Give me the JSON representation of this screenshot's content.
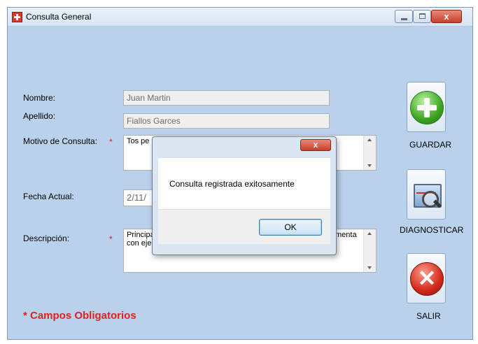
{
  "window": {
    "title": "Consulta General",
    "close_glyph": "x"
  },
  "form": {
    "nombre_label": "Nombre:",
    "nombre_value": "Juan Martin",
    "apellido_label": "Apellido:",
    "apellido_value": "Fiallos Garces",
    "motivo_label": "Motivo de Consulta:",
    "motivo_value": "Tos pe",
    "fecha_label": "Fecha Actual:",
    "fecha_value": "2/11/",
    "descripcion_label": "Descripción:",
    "descripcion_value_left": "Principa",
    "descripcion_value_line2": "con eje",
    "descripcion_value_right": "menta",
    "required_marker": "*",
    "required_note": "* Campos Obligatorios"
  },
  "buttons": {
    "guardar": "GUARDAR",
    "diagnosticar": "DIAGNOSTICAR",
    "salir": "SALIR"
  },
  "dialog": {
    "message": "Consulta registrada exitosamente",
    "ok_label": "OK",
    "close_glyph": "x"
  },
  "colors": {
    "client_bg": "#b9d1ea",
    "required": "#e0201e"
  }
}
